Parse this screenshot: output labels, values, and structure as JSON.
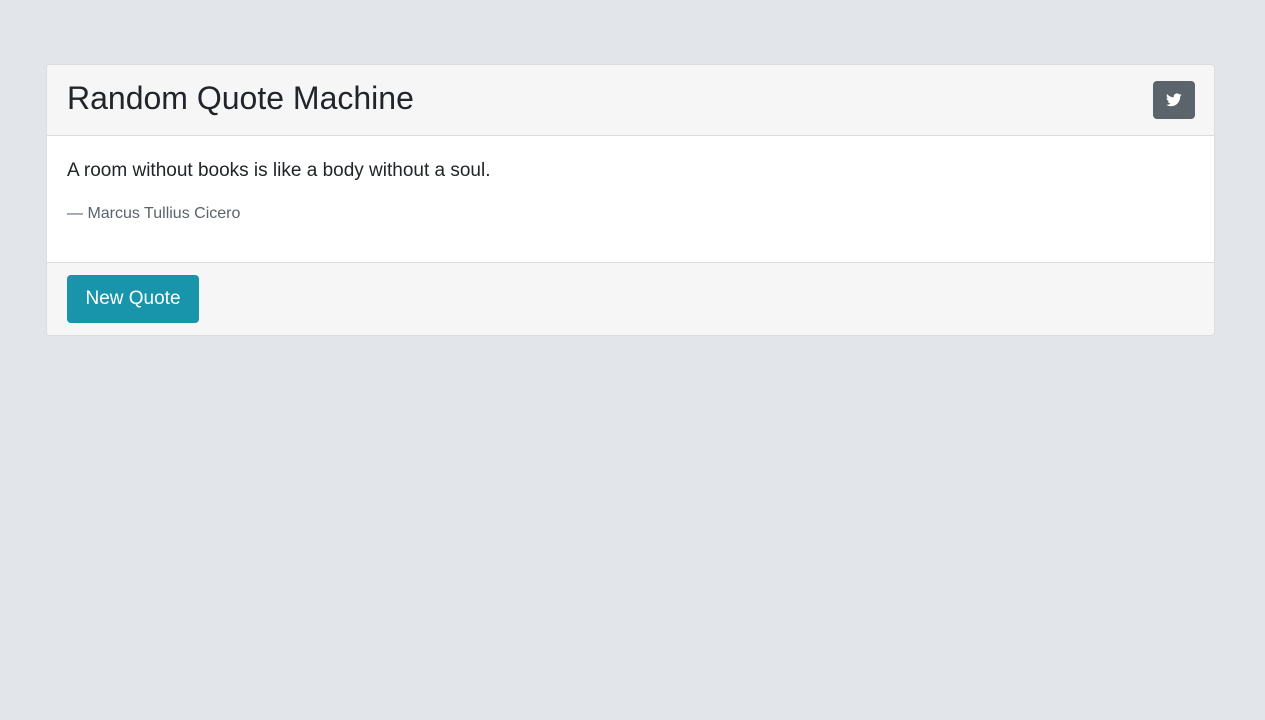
{
  "header": {
    "title": "Random Quote Machine",
    "tweet_button_icon": "twitter-icon"
  },
  "quote": {
    "text": "A room without books is like a body without a soul.",
    "author": "— Marcus Tullius Cicero"
  },
  "footer": {
    "new_quote_label": "New Quote"
  },
  "colors": {
    "page_background": "#e2e6eb",
    "card_header_background": "#f6f6f6",
    "tweet_button_background": "#5b636b",
    "new_quote_button_background": "#1995ab"
  }
}
